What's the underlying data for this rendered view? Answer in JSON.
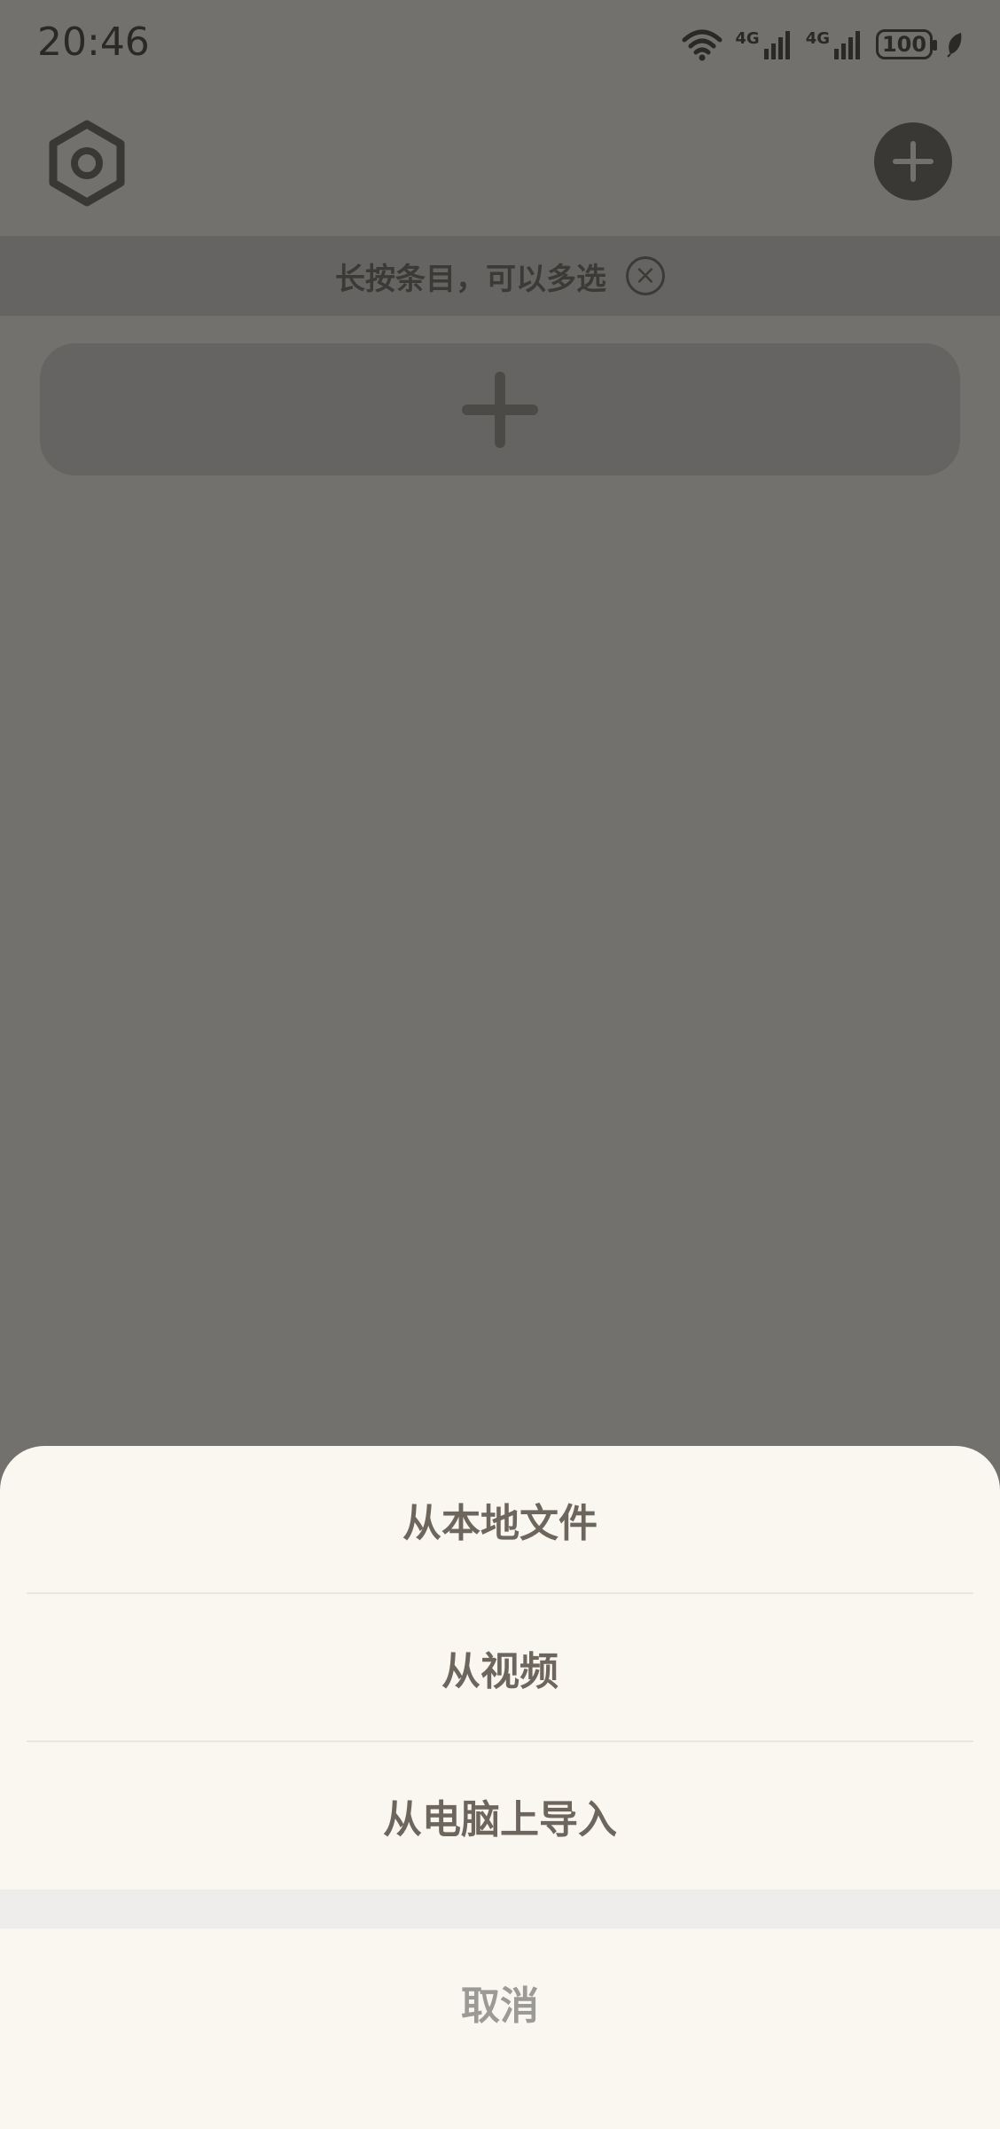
{
  "status_bar": {
    "time": "20:46",
    "network_1": "4G",
    "network_2": "4G",
    "battery": "100"
  },
  "header": {
    "settings_icon": "hexagon-settings-icon",
    "add_icon": "plus-icon"
  },
  "hint_banner": {
    "text": "长按条目，可以多选",
    "close_icon": "close-circle-icon"
  },
  "add_card": {
    "icon": "plus-icon"
  },
  "action_sheet": {
    "options": [
      {
        "label": "从本地文件"
      },
      {
        "label": "从视频"
      },
      {
        "label": "从电脑上导入"
      }
    ],
    "cancel_label": "取消"
  },
  "colors": {
    "overlay_bg": "#73716d",
    "sheet_bg": "#f9f7f0",
    "sheet_text": "#6c665d",
    "cancel_text": "#9c9a95"
  }
}
